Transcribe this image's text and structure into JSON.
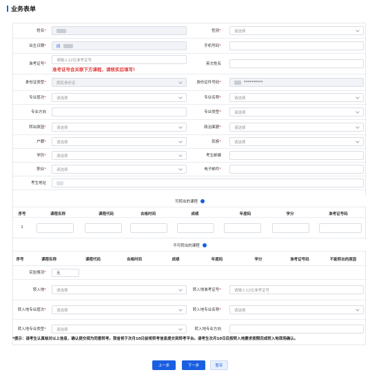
{
  "page": {
    "title": "业务表单"
  },
  "form": {
    "name": {
      "label": "姓名",
      "req": "*"
    },
    "gender": {
      "label": "性别",
      "req": "*",
      "placeholder": "请选择"
    },
    "birth": {
      "label": "出生日期",
      "req": "*",
      "value": "四"
    },
    "phone": {
      "label": "手机号码",
      "req": "*"
    },
    "ticket": {
      "label": "准考证号",
      "req": "*",
      "placeholder": "请输入12位准考证号",
      "warning": "准考证号会关联下方课程，请核实后填写!"
    },
    "english_name": {
      "label": "英文姓名"
    },
    "id_type": {
      "label": "身份证类型",
      "req": "*",
      "value": "居民身份证"
    },
    "id_no": {
      "label": "身份证件号码",
      "req": "*",
      "value": "**********"
    },
    "level": {
      "label": "专业层次",
      "req": "*",
      "placeholder": "请选择"
    },
    "major_name": {
      "label": "专业名称",
      "req": "*",
      "placeholder": "请选择"
    },
    "direction": {
      "label": "专业方向"
    },
    "major_type": {
      "label": "专业类型",
      "req": "*",
      "placeholder": "请选择"
    },
    "reason": {
      "label": "转出原因",
      "req": "*",
      "placeholder": "请选择"
    },
    "politics": {
      "label": "政治面貌",
      "req": "*",
      "placeholder": "请选择"
    },
    "hukou": {
      "label": "户籍",
      "req": "*",
      "placeholder": "请选择"
    },
    "nation": {
      "label": "民族",
      "req": "*",
      "placeholder": "请选择"
    },
    "edu": {
      "label": "学历",
      "req": "*",
      "placeholder": "请选择"
    },
    "zip": {
      "label": "考生邮编"
    },
    "job": {
      "label": "职业",
      "req": "*",
      "placeholder": "请选择"
    },
    "email": {
      "label": "电子邮件",
      "req": "*"
    },
    "address": {
      "label": "考生地址"
    }
  },
  "transfer_courses": {
    "title": "可转出的课程",
    "headers": [
      "序号",
      "课程名称",
      "课程代码",
      "合格时间",
      "成绩",
      "年度码",
      "学分",
      "准考证号码"
    ],
    "rows": [
      {
        "index": "1"
      }
    ]
  },
  "nontransfer_courses": {
    "title": "不可转出的课程",
    "headers": [
      "序号",
      "课程名称",
      "课程代码",
      "合格时间",
      "成绩",
      "年度码",
      "学分",
      "准考证号码",
      "不能转出的原因"
    ]
  },
  "exam_status": {
    "label": "实验情况",
    "req": "*",
    "value": "无"
  },
  "transfer_in": {
    "place": {
      "label": "转入地",
      "req": "*",
      "placeholder": "请选择"
    },
    "ticket": {
      "label": "转入地准考证号",
      "req": "*",
      "placeholder": "请输入12位准考证号"
    },
    "level": {
      "label": "转入地专业层次",
      "req": "*",
      "placeholder": "请选择"
    },
    "major_name": {
      "label": "转入地专业名称",
      "req": "*",
      "placeholder": "请选择"
    },
    "major_type": {
      "label": "转入地专业类型",
      "req": "*",
      "placeholder": "请选择"
    },
    "direction": {
      "label": "转入地专业方向"
    }
  },
  "notice": "*提示：请考生认真核对以上信息，确认提交视为同意转考。我省将于次月10日前将转考信息提交到转考平台。请考生次月10日后按转入地要求按照完成转入地现场确认。",
  "buttons": {
    "prev": "上一步",
    "next": "下一步",
    "save": "暂存"
  },
  "colors": {
    "accent": "#1a5fe0",
    "required": "#e23b3b",
    "border": "#d9dde4"
  }
}
